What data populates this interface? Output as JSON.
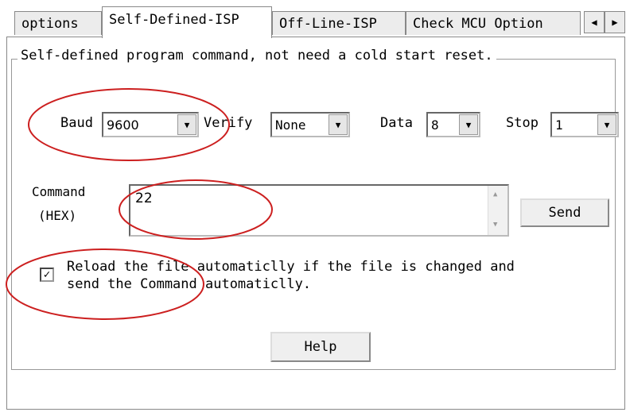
{
  "tabs": [
    "options",
    "Self-Defined-ISP",
    "Off-Line-ISP",
    "Check MCU Option"
  ],
  "active_tab": "Self-Defined-ISP",
  "group_title": "Self-defined program command, not need a cold start reset.",
  "baud": {
    "label": "Baud",
    "value": "9600"
  },
  "verify": {
    "label": "Verify",
    "value": "None"
  },
  "data_bits": {
    "label": "Data",
    "value": "8"
  },
  "stop_bits": {
    "label": "Stop",
    "value": "1"
  },
  "command": {
    "label_line1": "Command",
    "label_line2": "(HEX)",
    "value": "22"
  },
  "send_label": "Send",
  "checkbox": {
    "checked": true,
    "label_line1": "Reload the file automaticlly if the file is changed and",
    "label_line2": "send the Command automaticlly."
  },
  "help_label": "Help",
  "colors": {
    "annotation_red": "#cc1f1f",
    "panel_border": "#888888",
    "tab_bg": "#ececec"
  }
}
